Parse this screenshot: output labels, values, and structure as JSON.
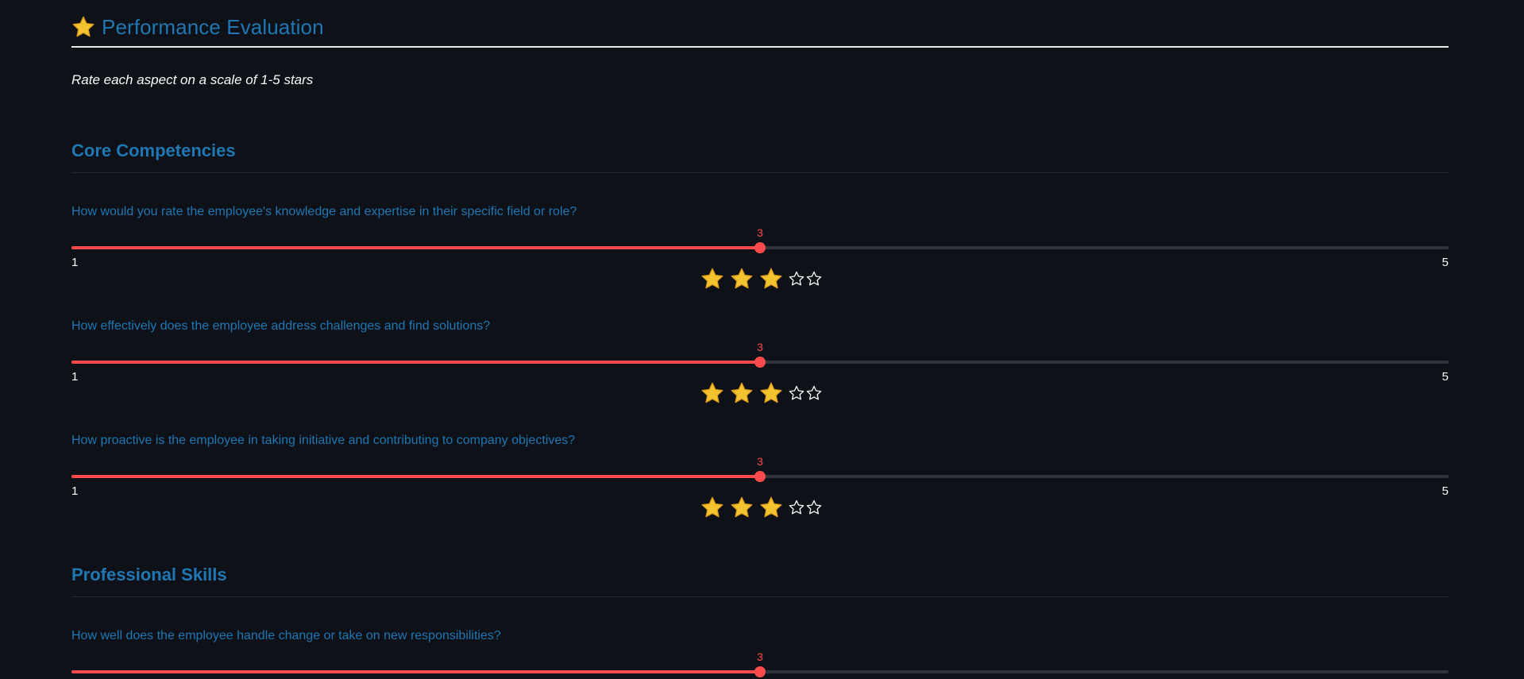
{
  "header": {
    "title": "Performance Evaluation",
    "title_icon": "star-icon",
    "subtitle": "Rate each aspect on a scale of 1-5 stars"
  },
  "sections": [
    {
      "title": "Core Competencies",
      "questions": [
        {
          "label": "How would you rate the employee's knowledge and expertise in their specific field or role?",
          "value": 3,
          "min": 1,
          "max": 5,
          "min_label": "1",
          "max_label": "5",
          "value_label": "3",
          "stars": "★★★☆☆"
        },
        {
          "label": "How effectively does the employee address challenges and find solutions?",
          "value": 3,
          "min": 1,
          "max": 5,
          "min_label": "1",
          "max_label": "5",
          "value_label": "3",
          "stars": "★★★☆☆"
        },
        {
          "label": "How proactive is the employee in taking initiative and contributing to company objectives?",
          "value": 3,
          "min": 1,
          "max": 5,
          "min_label": "1",
          "max_label": "5",
          "value_label": "3",
          "stars": "★★★☆☆"
        }
      ]
    },
    {
      "title": "Professional Skills",
      "questions": [
        {
          "label": "How well does the employee handle change or take on new responsibilities?",
          "value": 3,
          "min": 1,
          "max": 5,
          "value_label": "3"
        }
      ]
    }
  ],
  "colors": {
    "background": "#0e1117",
    "heading": "#1f77b4",
    "slider_accent": "#ff4b4b",
    "slider_track": "#31333b",
    "star_gold": "#f4c430"
  }
}
